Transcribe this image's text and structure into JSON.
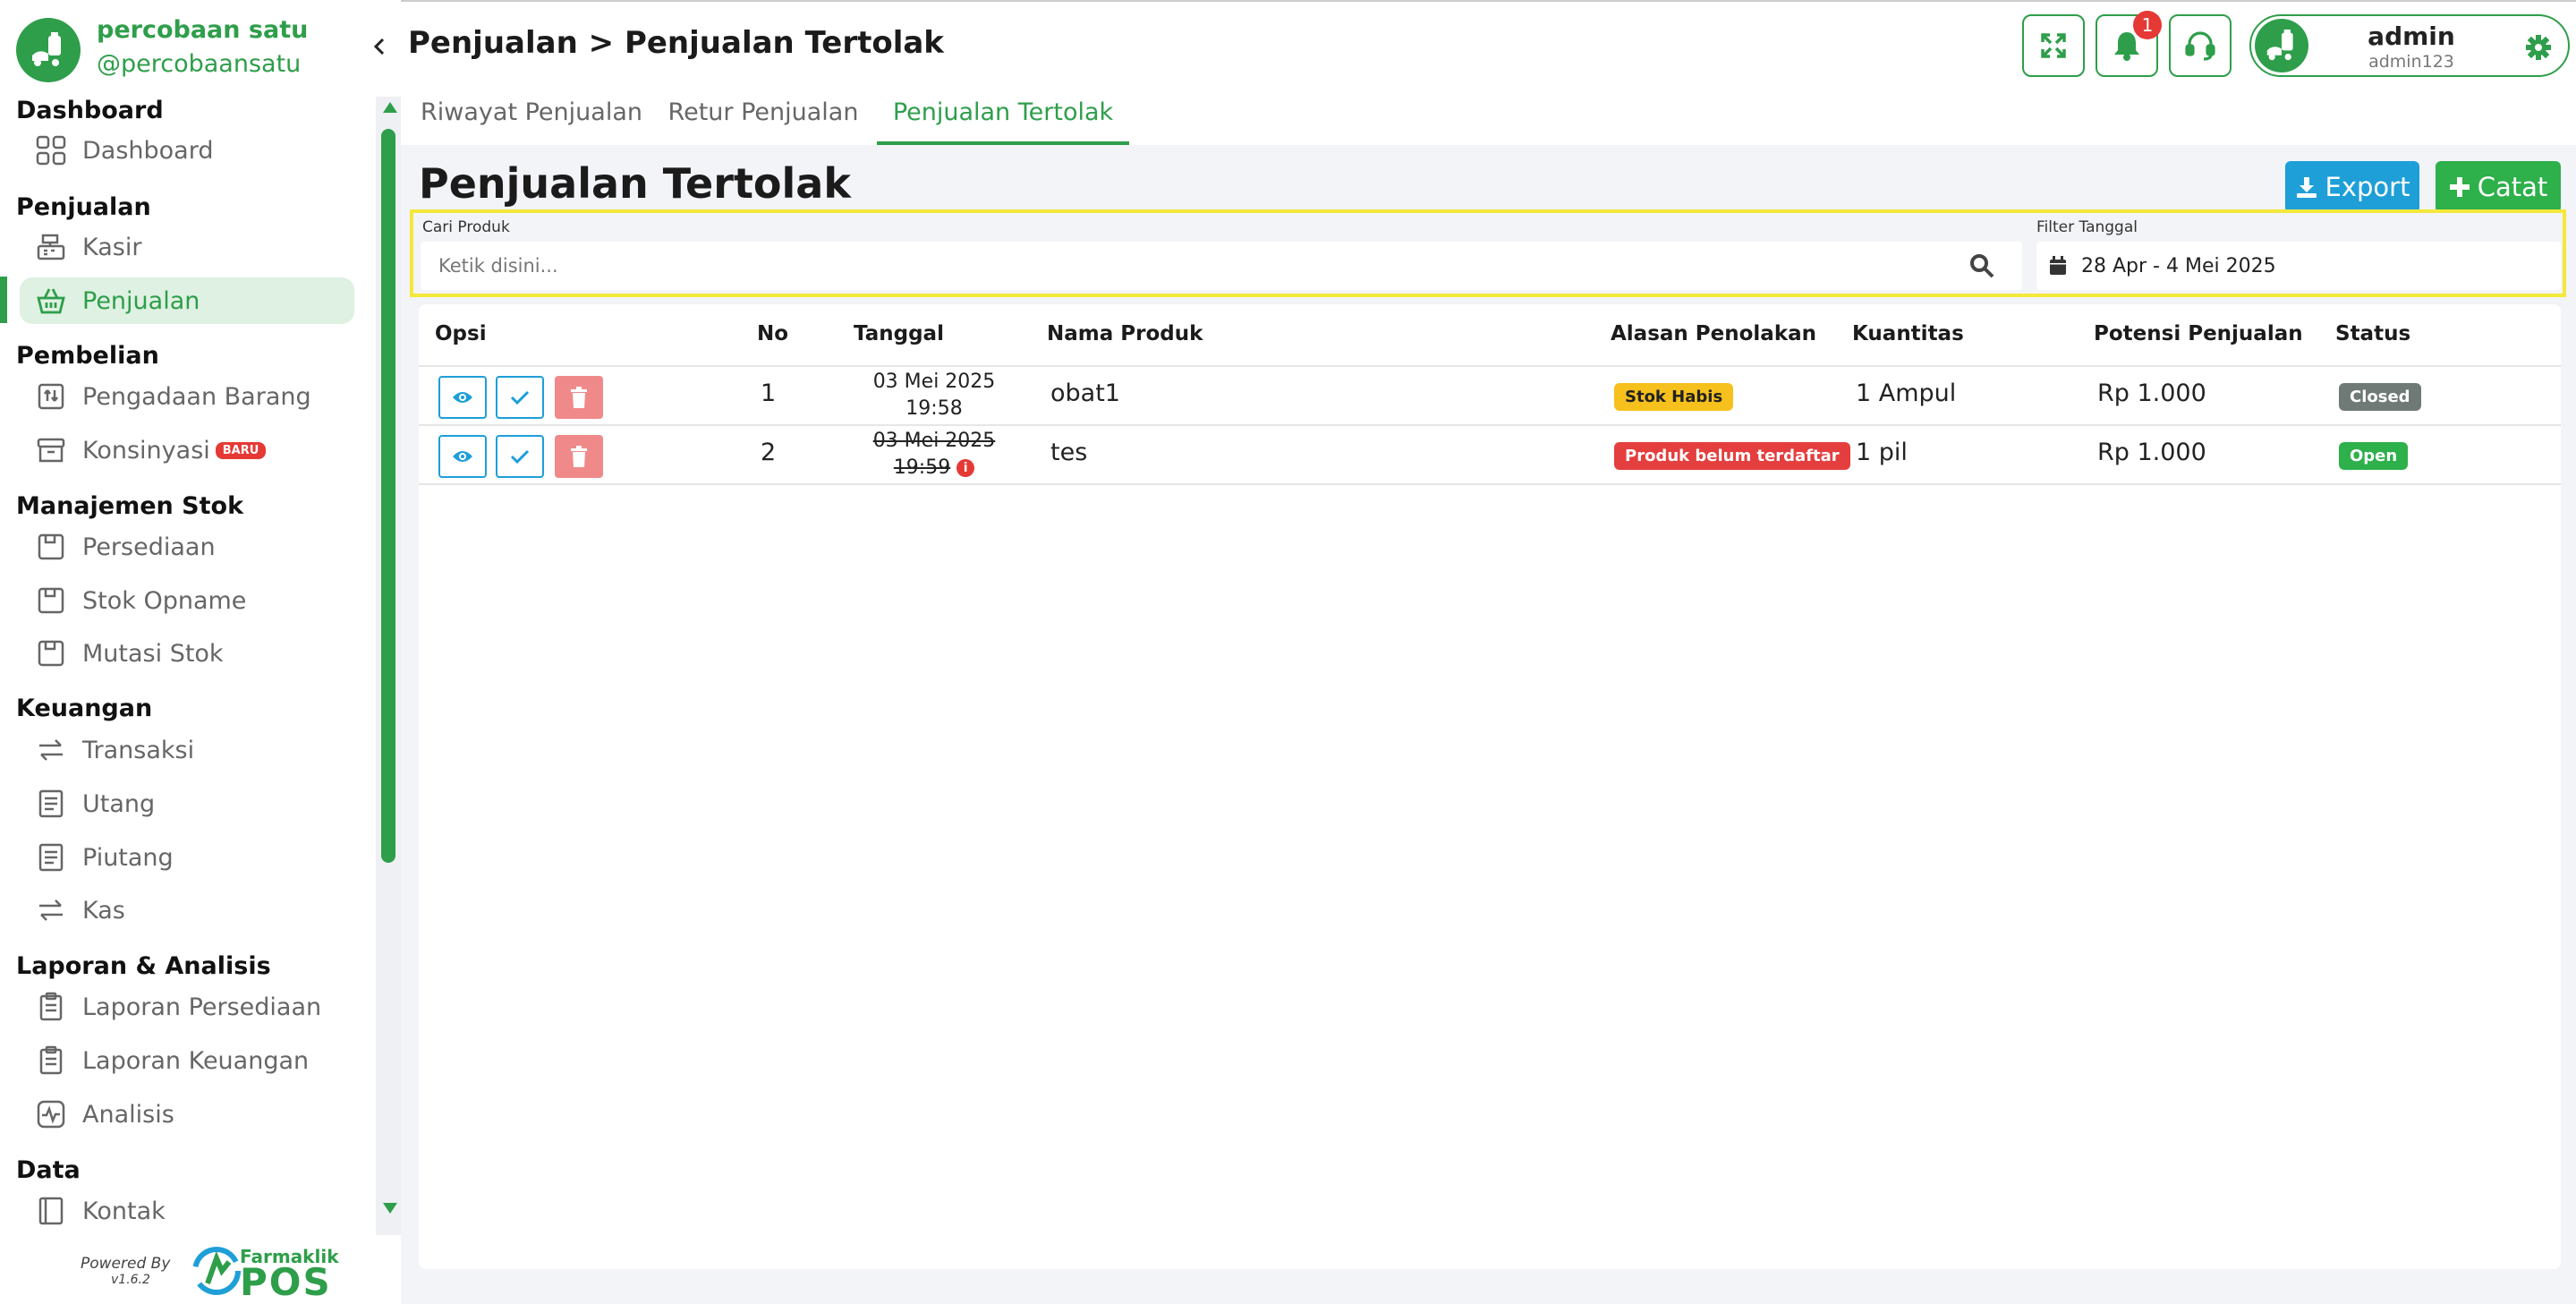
{
  "sidebar": {
    "brand_name": "percobaan satu",
    "brand_handle": "@percobaansatu",
    "sections": {
      "dashboard": "Dashboard",
      "penjualan": "Penjualan",
      "pembelian": "Pembelian",
      "manajemen_stok": "Manajemen Stok",
      "keuangan": "Keuangan",
      "laporan": "Laporan & Analisis",
      "data": "Data"
    },
    "items": {
      "dashboard": "Dashboard",
      "kasir": "Kasir",
      "penjualan": "Penjualan",
      "pengadaan": "Pengadaan Barang",
      "konsinyasi": "Konsinyasi",
      "konsinyasi_badge": "BARU",
      "persediaan": "Persediaan",
      "stok_opname": "Stok Opname",
      "mutasi_stok": "Mutasi Stok",
      "transaksi": "Transaksi",
      "utang": "Utang",
      "piutang": "Piutang",
      "kas": "Kas",
      "laporan_persediaan": "Laporan Persediaan",
      "laporan_keuangan": "Laporan Keuangan",
      "analisis": "Analisis",
      "kontak": "Kontak"
    },
    "active_item": "penjualan",
    "powered_by": "Powered By",
    "version": "v1.6.2",
    "footer_brand": "Farmaklik",
    "footer_product": "POS"
  },
  "header": {
    "breadcrumb": "Penjualan > Penjualan Tertolak",
    "notification_count": "1",
    "profile_name": "admin",
    "profile_username": "admin123"
  },
  "tabs": [
    {
      "label": "Riwayat Penjualan",
      "active": false
    },
    {
      "label": "Retur Penjualan",
      "active": false
    },
    {
      "label": "Penjualan Tertolak",
      "active": true
    }
  ],
  "page": {
    "title": "Penjualan Tertolak",
    "export_label": "Export",
    "catat_label": "Catat"
  },
  "filters": {
    "search_label": "Cari Produk",
    "search_placeholder": "Ketik disini...",
    "search_value": "",
    "date_label": "Filter Tanggal",
    "date_value": "28 Apr - 4 Mei 2025"
  },
  "table": {
    "columns": {
      "opsi": "Opsi",
      "no": "No",
      "tanggal": "Tanggal",
      "nama_produk": "Nama Produk",
      "alasan": "Alasan Penolakan",
      "kuantitas": "Kuantitas",
      "potensi": "Potensi Penjualan",
      "status": "Status"
    },
    "rows": [
      {
        "no": "1",
        "tanggal_date": "03 Mei 2025",
        "tanggal_time": "19:58",
        "nama_produk": "obat1",
        "alasan": "Stok Habis",
        "kuantitas": "1 Ampul",
        "potensi": "Rp 1.000",
        "status": "Closed"
      },
      {
        "no": "2",
        "tanggal_date": "03 Mei 2025",
        "tanggal_time": "19:59",
        "nama_produk": "tes",
        "alasan": "Produk belum terdaftar",
        "kuantitas": "1 pil",
        "potensi": "Rp 1.000",
        "status": "Open"
      }
    ]
  },
  "colors": {
    "primary": "#2e9e4a",
    "export": "#1e9fd8",
    "catat": "#2eb04a",
    "warn": "#f6c01d",
    "danger": "#e53e3e",
    "closed": "#6f7a76",
    "highlight": "#f3e83b"
  }
}
